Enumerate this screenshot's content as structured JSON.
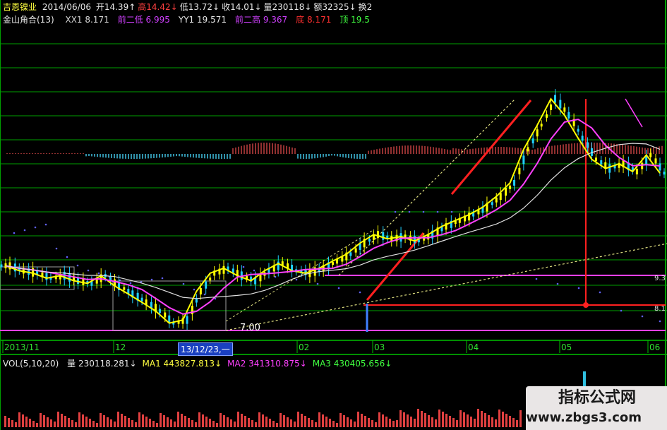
{
  "header": {
    "stock_name": "吉恩镍业",
    "date": "2014/06/06",
    "quote": [
      {
        "text": "开14.39↑",
        "color": "#e8e8e8"
      },
      {
        "text": "高14.42↓",
        "color": "#ff4040"
      },
      {
        "text": "低13.72↓",
        "color": "#e8e8e8"
      },
      {
        "text": "收14.01↓",
        "color": "#e8e8e8"
      },
      {
        "text": "量230118↓",
        "color": "#e8e8e8"
      },
      {
        "text": "额32325↓",
        "color": "#e8e8e8"
      },
      {
        "text": "换2",
        "color": "#e8e8e8"
      }
    ],
    "indicator_name": "金山角合(13)",
    "indicators": [
      {
        "text": "XX1 8.171",
        "color": "#d8d8d8"
      },
      {
        "text": "前二低 6.995",
        "color": "#d040ff"
      },
      {
        "text": "YY1 19.571",
        "color": "#e8e8e8"
      },
      {
        "text": "前二高 9.367",
        "color": "#d040ff"
      },
      {
        "text": "底 8.171",
        "color": "#ff3030"
      },
      {
        "text": "顶 19.5",
        "color": "#40ff40"
      }
    ]
  },
  "price_labels": {
    "low_marker": "7.00",
    "right_top": "9.3",
    "right_mid": "8.1"
  },
  "x_axis": {
    "ticks": [
      "2013/11",
      "12",
      "02",
      "03",
      "04",
      "05",
      "06"
    ],
    "cursor_label": "13/12/23,一"
  },
  "vol_header": {
    "name": "VOL(5,10,20)",
    "items": [
      {
        "text": "量 230118.281↓",
        "color": "#e8e8e8"
      },
      {
        "text": "MA1 443827.813↓",
        "color": "#ffff40"
      },
      {
        "text": "MA2 341310.875↓",
        "color": "#ff40ff"
      },
      {
        "text": "MA3 430405.656↓",
        "color": "#40ff40"
      }
    ]
  },
  "watermark": {
    "title": "指标公式网",
    "url": "www.zbgs3.com"
  },
  "colors": {
    "up": "#ffff00",
    "down": "#20d0ff",
    "ma_short": "#ffff00",
    "ma_mid": "#ff40ff",
    "ma_long": "#e0e0e0",
    "trend_line": "#ff2020",
    "grid": "#00a000"
  },
  "chart_data": {
    "type": "candlestick",
    "x": [
      "2013/11",
      "12",
      "02",
      "03",
      "04",
      "05",
      "06"
    ],
    "close_series": [
      9.2,
      9.0,
      8.9,
      8.7,
      8.8,
      8.6,
      8.5,
      8.8,
      8.4,
      8.1,
      7.8,
      7.5,
      7.1,
      7.2,
      8.2,
      8.9,
      9.1,
      8.8,
      8.6,
      9.0,
      9.3,
      9.0,
      8.9,
      9.1,
      9.4,
      9.7,
      10.2,
      10.6,
      10.4,
      10.5,
      10.3,
      10.6,
      11.0,
      11.3,
      11.6,
      12.0,
      12.6,
      13.4,
      15.6,
      17.4,
      19.6,
      18.2,
      16.4,
      14.9,
      14.3,
      14.6,
      14.1,
      15.2,
      14.0
    ],
    "levels": {
      "low": 7.0,
      "support": 8.171,
      "previous_high": 9.367,
      "top": 19.571
    }
  }
}
